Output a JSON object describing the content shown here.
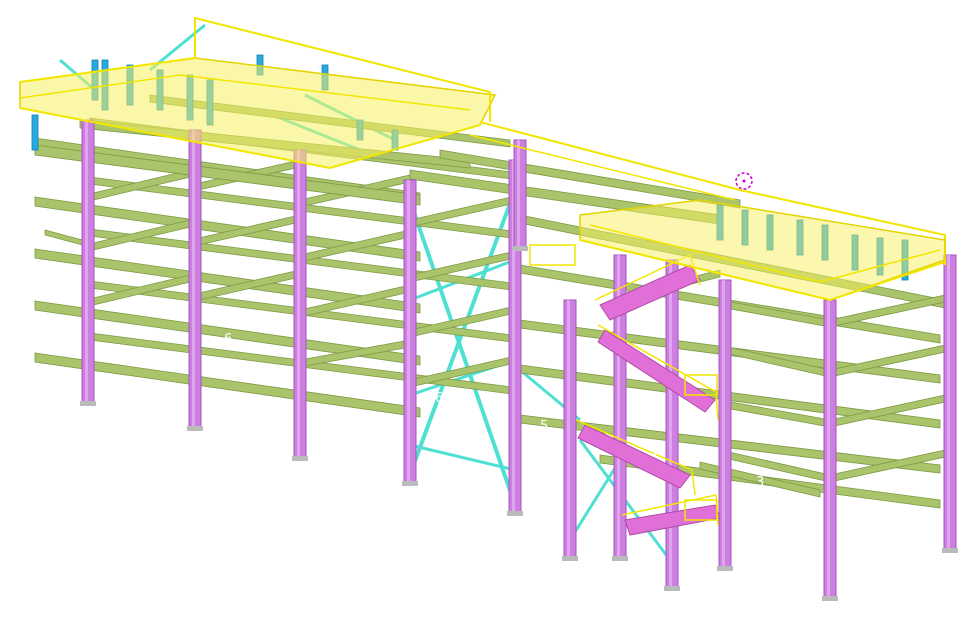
{
  "colors": {
    "background": "#ffffff",
    "column": "#cc7fe0",
    "column_edge": "#a455bf",
    "beam": "#a9c46a",
    "beam_edge": "#7f9a45",
    "brace": "#4fe0d4",
    "post": "#2aa9e0",
    "handrail": "#f2e600",
    "stair": "#e070d8",
    "marker": "#d000d0"
  },
  "grid_labels": [
    "6",
    "6",
    "5",
    "5",
    "3",
    "2"
  ]
}
